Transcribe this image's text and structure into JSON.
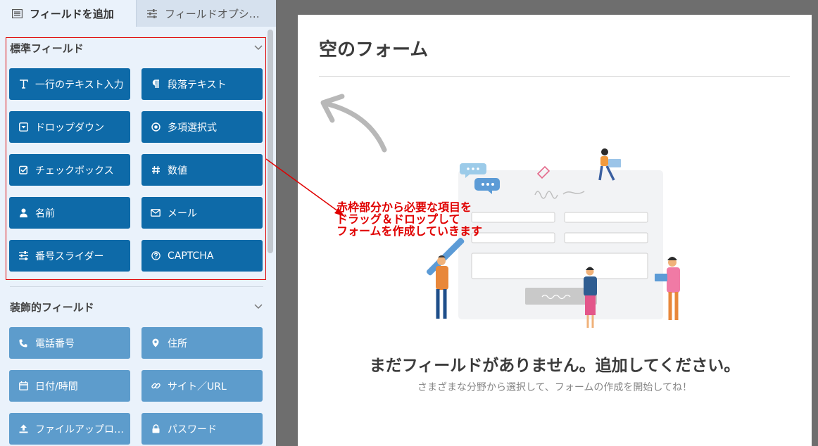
{
  "tabs": {
    "add_field": "フィールドを追加",
    "field_options": "フィールドオプシ…"
  },
  "sections": {
    "standard": {
      "title": "標準フィールド",
      "buttons": [
        {
          "label": "一行のテキスト入力",
          "icon": "text-icon"
        },
        {
          "label": "段落テキスト",
          "icon": "paragraph-icon"
        },
        {
          "label": "ドロップダウン",
          "icon": "dropdown-icon"
        },
        {
          "label": "多項選択式",
          "icon": "radio-icon"
        },
        {
          "label": "チェックボックス",
          "icon": "checkbox-icon"
        },
        {
          "label": "数値",
          "icon": "hash-icon"
        },
        {
          "label": "名前",
          "icon": "user-icon"
        },
        {
          "label": "メール",
          "icon": "envelope-icon"
        },
        {
          "label": "番号スライダー",
          "icon": "sliders-icon"
        },
        {
          "label": "CAPTCHA",
          "icon": "question-icon"
        }
      ]
    },
    "decorative": {
      "title": "装飾的フィールド",
      "buttons": [
        {
          "label": "電話番号",
          "icon": "phone-icon"
        },
        {
          "label": "住所",
          "icon": "map-pin-icon"
        },
        {
          "label": "日付/時間",
          "icon": "calendar-icon"
        },
        {
          "label": "サイト／URL",
          "icon": "link-icon"
        },
        {
          "label": "ファイルアップロ…",
          "icon": "upload-icon"
        },
        {
          "label": "パスワード",
          "icon": "lock-icon"
        }
      ]
    }
  },
  "form": {
    "title": "空のフォーム",
    "empty_title": "まだフィールドがありません。追加してください。",
    "empty_subtitle": "さまざまな分野から選択して、フォームの作成を開始してね！"
  },
  "annotation": {
    "line1": "赤枠部分から必要な項目を",
    "line2": "ドラッグ＆ドロップして",
    "line3": "フォームを作成していきます"
  },
  "colors": {
    "standard_button": "#0e6aa8",
    "decorative_button": "#5d9ccc",
    "annotation_red": "#e00000"
  }
}
